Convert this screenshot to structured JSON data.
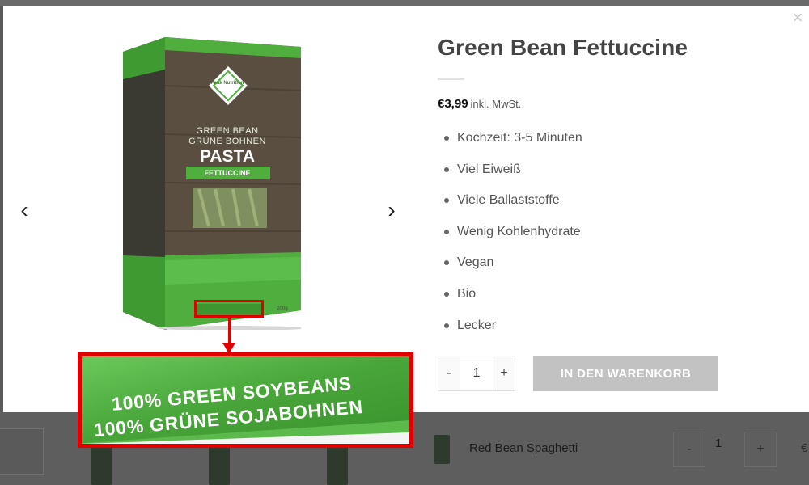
{
  "product": {
    "title": "Green Bean Fettuccine",
    "price": "€3,99",
    "price_suffix": "inkl. MwSt.",
    "features": [
      "Kochzeit: 3-5 Minuten",
      "Viel Eiweiß",
      "Viele Ballaststoffe",
      "Wenig Kohlenhydrate",
      "Vegan",
      "Bio",
      "Lecker"
    ],
    "quantity": "1",
    "qty_minus": "-",
    "qty_plus": "+",
    "add_to_cart": "IN DEN WARENKORB"
  },
  "gallery": {
    "prev_icon": "‹",
    "next_icon": "›",
    "close_icon": "×",
    "box": {
      "line1": "GREEN BEAN",
      "line2": "GRÜNE BOHNEN",
      "title": "PASTA",
      "subtitle": "FETTUCCINE",
      "brand": "Peak Nutrition",
      "weight": "200g"
    },
    "zoom": {
      "line1": "100% GREEN SOYBEANS",
      "line2": "100% GRÜNE SOJABOHNEN"
    }
  },
  "background": {
    "row_product": "Red Bean Spaghetti",
    "qty": "1",
    "minus": "-",
    "plus": "+",
    "price": "€"
  },
  "colors": {
    "box_green": "#4fae3e",
    "annotation_red": "#e00000",
    "button_disabled": "#c2c2c2"
  }
}
